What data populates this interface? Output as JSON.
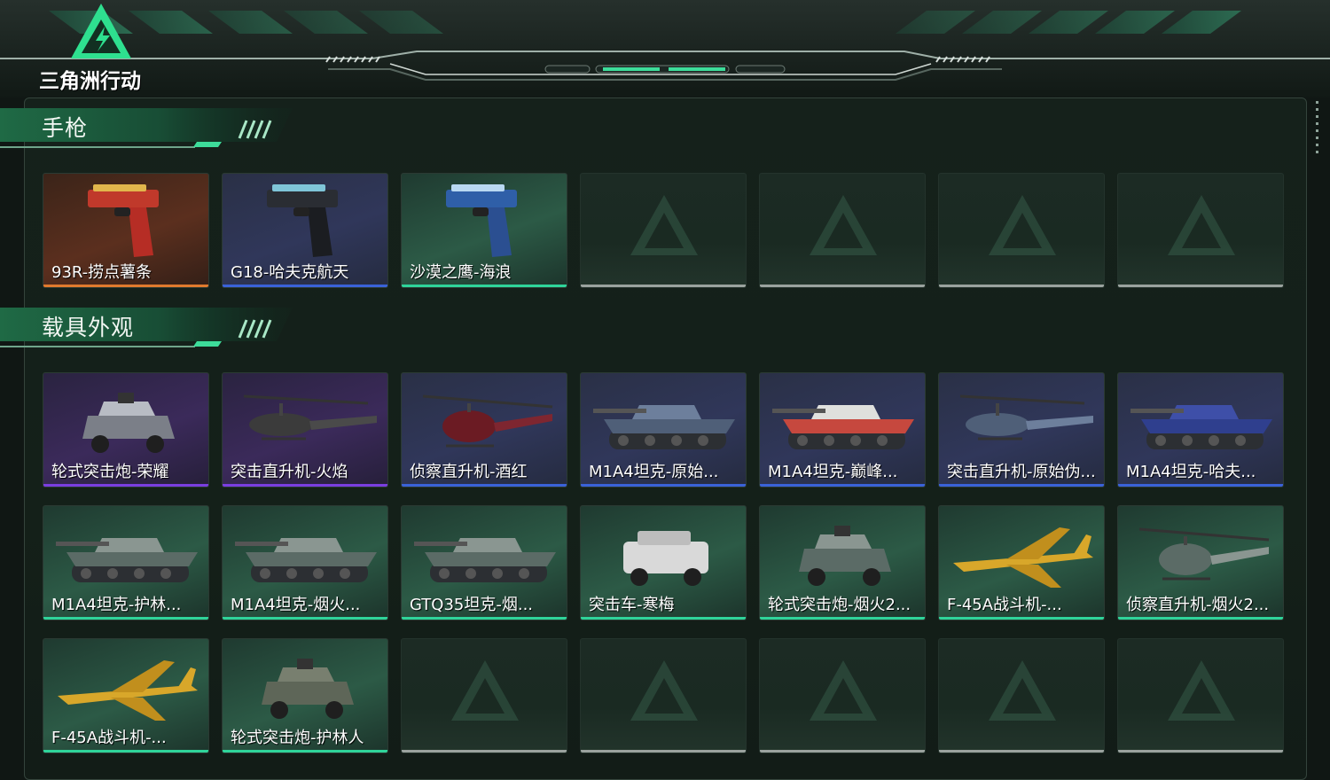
{
  "header": {
    "game_title": "三角洲行动"
  },
  "sections": [
    {
      "title": "手枪",
      "items": [
        {
          "label": "93R-捞点薯条",
          "rarity": "orange",
          "icon": "pistol-icon",
          "color": "#e07a2e"
        },
        {
          "label": "G18-哈夫克航天",
          "rarity": "blue",
          "icon": "pistol-icon",
          "color": "#3a62d8"
        },
        {
          "label": "沙漠之鹰-海浪",
          "rarity": "green",
          "icon": "pistol-icon",
          "color": "#2fd49a"
        },
        {
          "label": "",
          "rarity": "empty"
        },
        {
          "label": "",
          "rarity": "empty"
        },
        {
          "label": "",
          "rarity": "empty"
        },
        {
          "label": "",
          "rarity": "empty"
        }
      ]
    },
    {
      "title": "载具外观",
      "items": [
        {
          "label": "轮式突击炮-荣耀",
          "rarity": "purple",
          "icon": "armored-car-icon",
          "color": "#7a3ee0"
        },
        {
          "label": "突击直升机-火焰",
          "rarity": "purple",
          "icon": "attack-helicopter-icon",
          "color": "#7a3ee0"
        },
        {
          "label": "侦察直升机-酒红",
          "rarity": "blue",
          "icon": "scout-helicopter-icon",
          "color": "#3a62d8"
        },
        {
          "label": "M1A4坦克-原始...",
          "rarity": "blue",
          "icon": "tank-icon",
          "color": "#3a62d8"
        },
        {
          "label": "M1A4坦克-巅峰...",
          "rarity": "blue",
          "icon": "tank-icon",
          "color": "#3a62d8"
        },
        {
          "label": "突击直升机-原始伪...",
          "rarity": "blue",
          "icon": "attack-helicopter-icon",
          "color": "#3a62d8"
        },
        {
          "label": "M1A4坦克-哈夫...",
          "rarity": "blue",
          "icon": "tank-icon",
          "color": "#3a62d8"
        },
        {
          "label": "M1A4坦克-护林...",
          "rarity": "green",
          "icon": "tank-icon",
          "color": "#2fd49a"
        },
        {
          "label": "M1A4坦克-烟火...",
          "rarity": "green",
          "icon": "tank-icon",
          "color": "#2fd49a"
        },
        {
          "label": "GTQ35坦克-烟...",
          "rarity": "green",
          "icon": "tank-icon",
          "color": "#2fd49a"
        },
        {
          "label": "突击车-寒梅",
          "rarity": "green",
          "icon": "assault-vehicle-icon",
          "color": "#2fd49a"
        },
        {
          "label": "轮式突击炮-烟火2...",
          "rarity": "green",
          "icon": "armored-car-icon",
          "color": "#2fd49a"
        },
        {
          "label": "F-45A战斗机-...",
          "rarity": "green",
          "icon": "fighter-jet-icon",
          "color": "#2fd49a"
        },
        {
          "label": "侦察直升机-烟火2...",
          "rarity": "green",
          "icon": "scout-helicopter-icon",
          "color": "#2fd49a"
        },
        {
          "label": "F-45A战斗机-...",
          "rarity": "green",
          "icon": "fighter-jet-icon",
          "color": "#2fd49a"
        },
        {
          "label": "轮式突击炮-护林人",
          "rarity": "green",
          "icon": "armored-car-icon",
          "color": "#2fd49a"
        },
        {
          "label": "",
          "rarity": "empty"
        },
        {
          "label": "",
          "rarity": "empty"
        },
        {
          "label": "",
          "rarity": "empty"
        },
        {
          "label": "",
          "rarity": "empty"
        },
        {
          "label": "",
          "rarity": "empty"
        }
      ]
    }
  ],
  "colors": {
    "accent": "#27c08a",
    "panel_border": "#34443c"
  }
}
